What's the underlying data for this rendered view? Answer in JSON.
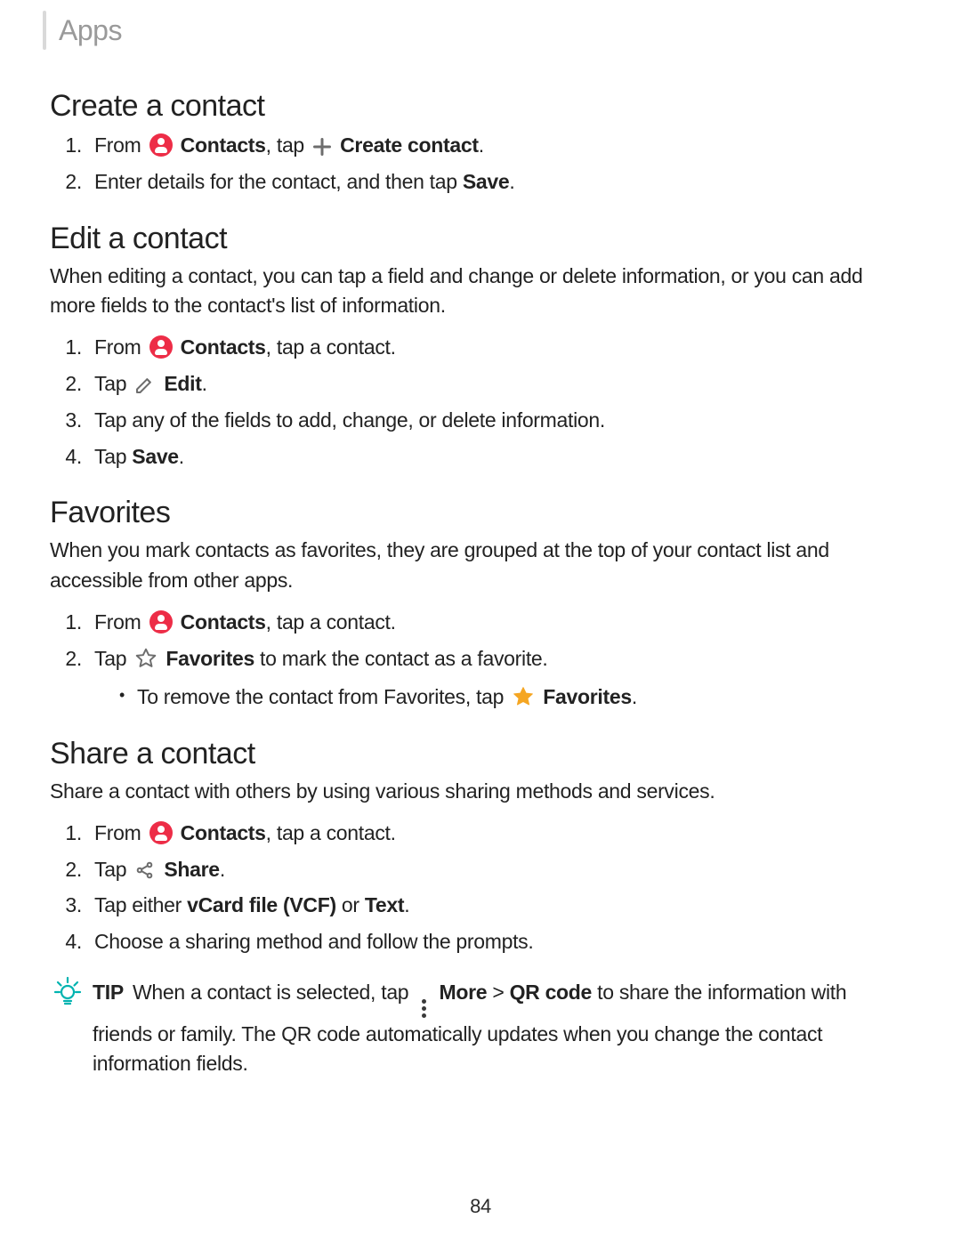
{
  "header": {
    "breadcrumb": "Apps"
  },
  "create": {
    "title": "Create a contact",
    "step1_before": "From",
    "step1_contacts": "Contacts",
    "step1_mid": ", tap",
    "step1_create": "Create contact",
    "step1_end": ".",
    "step2_a": "Enter details for the contact, and then tap ",
    "step2_b": "Save",
    "step2_c": "."
  },
  "edit": {
    "title": "Edit a contact",
    "intro": "When editing a contact, you can tap a field and change or delete information, or you can add more fields to the contact's list of information.",
    "step1_before": "From",
    "step1_contacts": "Contacts",
    "step1_after": ", tap a contact.",
    "step2_before": "Tap",
    "step2_edit": "Edit",
    "step2_end": ".",
    "step3": "Tap any of the fields to add, change, or delete information.",
    "step4_a": "Tap ",
    "step4_b": "Save",
    "step4_c": "."
  },
  "favorites": {
    "title": "Favorites",
    "intro": "When you mark contacts as favorites, they are grouped at the top of your contact list and accessible from other apps.",
    "step1_before": "From",
    "step1_contacts": "Contacts",
    "step1_after": ", tap a contact.",
    "step2_before": "Tap",
    "step2_fav": "Favorites",
    "step2_after": " to mark the contact as a favorite.",
    "sub_before": "To remove the contact from Favorites, tap",
    "sub_fav": "Favorites",
    "sub_end": "."
  },
  "share": {
    "title": "Share a contact",
    "intro": "Share a contact with others by using various sharing methods and services.",
    "step1_before": "From",
    "step1_contacts": "Contacts",
    "step1_after": ", tap a contact.",
    "step2_before": "Tap",
    "step2_share": "Share",
    "step2_end": ".",
    "step3_a": "Tap either ",
    "step3_b": "vCard file (VCF)",
    "step3_c": " or ",
    "step3_d": "Text",
    "step3_e": ".",
    "step4": "Choose a sharing method and follow the prompts."
  },
  "tip": {
    "label": "TIP",
    "t1": " When a contact is selected, tap",
    "more": "More",
    "gt": " > ",
    "qr": "QR code",
    "t2": " to share the information with friends or family. The QR code automatically updates when you change the contact information fields."
  },
  "page_number": "84"
}
